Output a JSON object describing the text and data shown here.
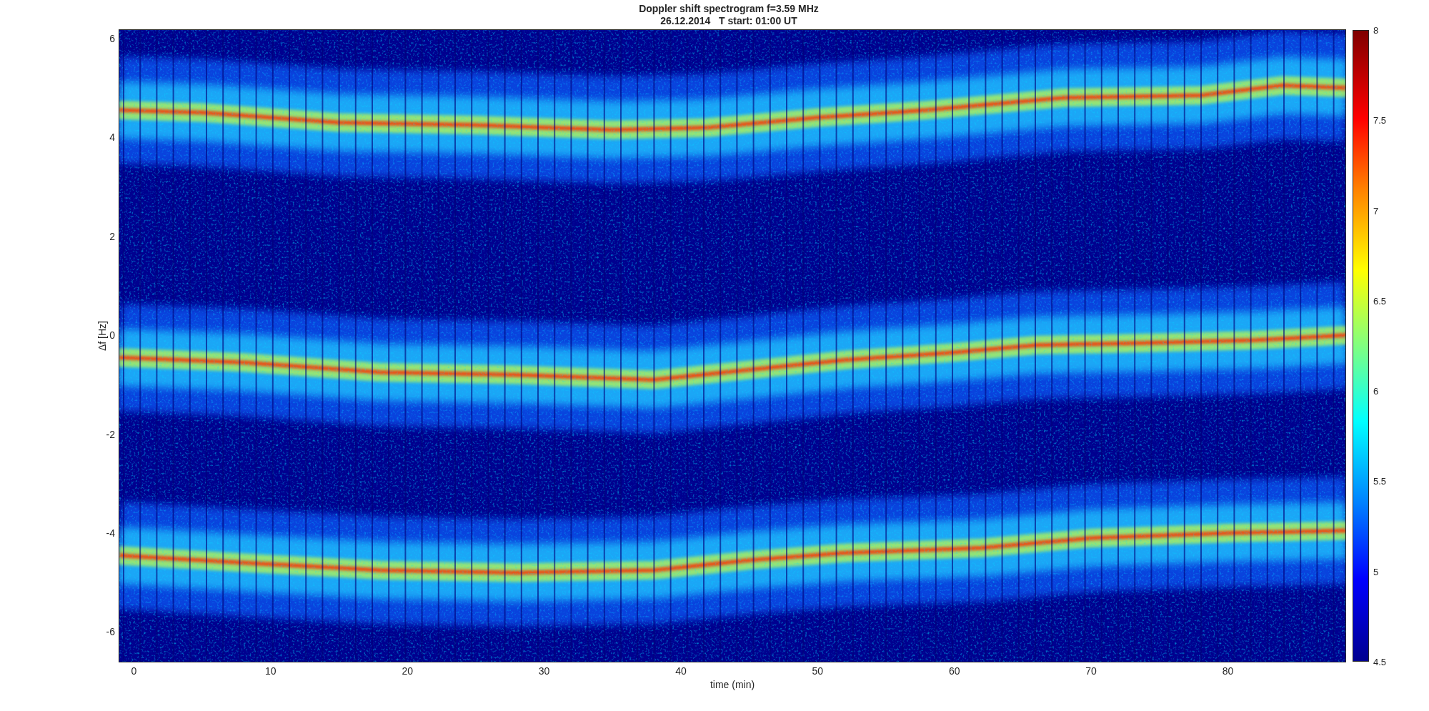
{
  "title": [
    "Doppler shift spectrogram f=3.59 MHz",
    "26.12.2014   T start: 01:00 UT"
  ],
  "plot": {
    "xlabel": "time (min)",
    "ylabel": "Δf [Hz]",
    "xticks": [
      "0",
      "10",
      "20",
      "30",
      "40",
      "50",
      "60",
      "70",
      "80"
    ],
    "yticks": [
      "6",
      "4",
      "2",
      "0",
      "-2",
      "-4",
      "-6"
    ]
  },
  "colorbar": {
    "ticks": [
      "8",
      "7.5",
      "7",
      "6.5",
      "6",
      "5.5",
      "5",
      "4.5"
    ]
  }
}
